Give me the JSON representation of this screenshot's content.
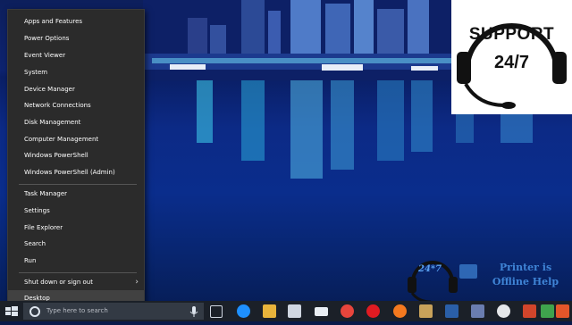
{
  "winx_menu": {
    "items": [
      {
        "label": "Apps and Features"
      },
      {
        "label": "Power Options"
      },
      {
        "label": "Event Viewer"
      },
      {
        "label": "System"
      },
      {
        "label": "Device Manager"
      },
      {
        "label": "Network Connections"
      },
      {
        "label": "Disk Management"
      },
      {
        "label": "Computer Management"
      },
      {
        "label": "Windows PowerShell"
      },
      {
        "label": "Windows PowerShell (Admin)"
      },
      {
        "label": "Task Manager"
      },
      {
        "label": "Settings"
      },
      {
        "label": "File Explorer"
      },
      {
        "label": "Search"
      },
      {
        "label": "Run"
      },
      {
        "label": "Shut down or sign out"
      },
      {
        "label": "Desktop"
      }
    ],
    "submenu_arrow": "›"
  },
  "support_logo": {
    "line1": "SUPPORT",
    "line2": "24/7"
  },
  "watermark": {
    "badge": "24*7",
    "line1": "Printer is",
    "line2": "Offline Help"
  },
  "taskbar": {
    "search_placeholder": "Type here to search",
    "pinned_icons": [
      {
        "name": "task-view-icon"
      },
      {
        "name": "edge-icon"
      },
      {
        "name": "file-explorer-icon"
      },
      {
        "name": "store-icon"
      },
      {
        "name": "mail-icon"
      },
      {
        "name": "chrome-icon"
      },
      {
        "name": "opera-icon"
      },
      {
        "name": "firefox-icon"
      },
      {
        "name": "app-icon"
      },
      {
        "name": "photoshop-icon"
      },
      {
        "name": "app-icon-2"
      },
      {
        "name": "app-icon-3"
      },
      {
        "name": "app-icon-4"
      },
      {
        "name": "app-icon-5"
      },
      {
        "name": "app-icon-6"
      }
    ],
    "colors": {
      "edge": "#1e90ff",
      "chrome": "#e8453c",
      "opera": "#e01b22",
      "firefox": "#f4791f",
      "photoshop": "#2a5fa8"
    }
  }
}
